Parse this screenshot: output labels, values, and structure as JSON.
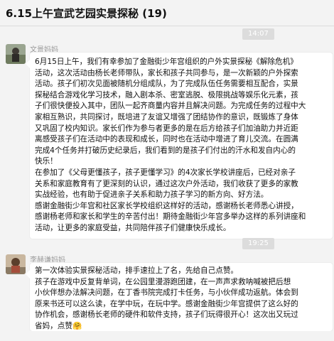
{
  "chat": {
    "title": "6.15上午宣武艺园实景探秘 (19)"
  },
  "timestamps": [
    "14:07",
    "19:25"
  ],
  "messages": [
    {
      "sender": "文景妈妈",
      "lines": [
        "6月15日上午，我们有幸参加了金融街少年宫组织的户外实景探秘《解除危机》",
        "活动，这次活动由杨长老师带队，家长和孩子共同参与，是一次新颖的户外探索",
        "活动。孩子们初次见面被随机分组成队，为了完成队伍任务需要相互配合，实景",
        "探秘结合游戏化学习技术，融入剧本杀、密室逃脱、极限挑战等娱乐化元素，孩",
        "子们很快便投入其中，团队一起齐商量内容并且解决问题。为完成任务的过程中大",
        "家相互熟识，共同探讨，既培进了友谊又增强了团结协作的意识，既锻炼了身体",
        "又巩固了校内知识。家长们作为参与者更多的是在后方给孩子们加油助力并近距",
        "离感受孩子们在活动中的表现和成长，同时也在活动中增进了育儿交流。在圆满",
        "完成4个任务并打破历史纪录后，我们看到的是孩子们付出的汗水和发自内心的",
        "快乐！",
        "在参加了《父母更懂孩子，孩子更懂学习》的4次家长学校讲座后，已经对亲子",
        "关系和家庭教育有了更深刻的认识，通过这次户外活动，我们收获了更多的家教",
        "实战经验，也有助于促进亲子关系和助力孩子学习的新方向、好方法。",
        "感谢金融街少年宫和社区家长学校组织这样好的活动，感谢杨长老师悉心讲授，",
        "感谢杨老师和家长和学生的辛苦付出！期待金融街少年宫多举办这样的系列讲座和",
        "活动，让更多的家庭受益，共同陪伴孩子们健康快乐成长。"
      ]
    },
    {
      "sender": "李赫谦妈妈",
      "lines": [
        "第一次体验实景探秘活动，排手速拉上了名，先给自己点赞。",
        "孩子在游戏中反复背单词，在公园里漫游跑团建，在一声声求救呐喊被把后想",
        "小伙伴想办法解决问题，在丁香书院完成打卡任务，与小伙伴成功返航。体会到",
        "原来书还可以这么读，在学中玩，在玩中学。感谢金融街少年宫提供了这么好的",
        "协作机会，感谢杨长老师的硬件和软件支持，孩子们玩得很开心！这次出又玩过",
        "省妈，点赞🤗"
      ]
    }
  ],
  "colors": {
    "background": "#f3f3f3",
    "bubble": "#ffffff",
    "timestamp_chip": "#dcdcdc",
    "sender_name": "#9a9a9a"
  }
}
